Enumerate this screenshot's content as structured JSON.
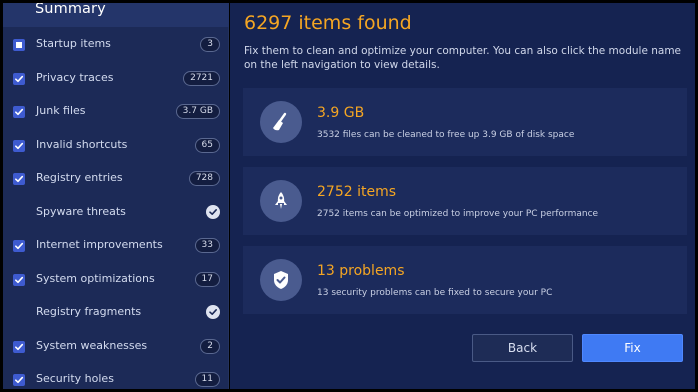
{
  "sidebar": {
    "title": "Summary",
    "items": [
      {
        "label": "Startup items",
        "badge": "3",
        "checkbox": "partial"
      },
      {
        "label": "Privacy traces",
        "badge": "2721",
        "checkbox": "checked"
      },
      {
        "label": "Junk files",
        "badge": "3.7 GB",
        "checkbox": "checked"
      },
      {
        "label": "Invalid shortcuts",
        "badge": "65",
        "checkbox": "checked"
      },
      {
        "label": "Registry entries",
        "badge": "728",
        "checkbox": "checked"
      },
      {
        "label": "Spyware threats",
        "badge": "",
        "checkbox": "none"
      },
      {
        "label": "Internet improvements",
        "badge": "33",
        "checkbox": "checked"
      },
      {
        "label": "System optimizations",
        "badge": "17",
        "checkbox": "checked"
      },
      {
        "label": "Registry fragments",
        "badge": "",
        "checkbox": "none"
      },
      {
        "label": "System weaknesses",
        "badge": "2",
        "checkbox": "checked"
      },
      {
        "label": "Security holes",
        "badge": "11",
        "checkbox": "checked"
      }
    ]
  },
  "main": {
    "title": "6297 items found",
    "description": "Fix them to clean and optimize your computer. You can also click the module name on the left navigation to view details.",
    "cards": [
      {
        "icon": "broom-icon",
        "value": "3.9 GB",
        "desc": "3532 files can be cleaned to free up 3.9 GB of disk space"
      },
      {
        "icon": "rocket-icon",
        "value": "2752 items",
        "desc": "2752 items can be optimized to improve your PC performance"
      },
      {
        "icon": "shield-icon",
        "value": "13 problems",
        "desc": "13 security problems can be fixed to secure your PC"
      }
    ]
  },
  "buttons": {
    "back": "Back",
    "fix": "Fix"
  },
  "colors": {
    "accent": "#f5a623",
    "primary_button": "#3f7af3",
    "sidebar_bg": "#1c2a57",
    "main_bg": "#152351",
    "card_bg": "#1c2b5c"
  }
}
